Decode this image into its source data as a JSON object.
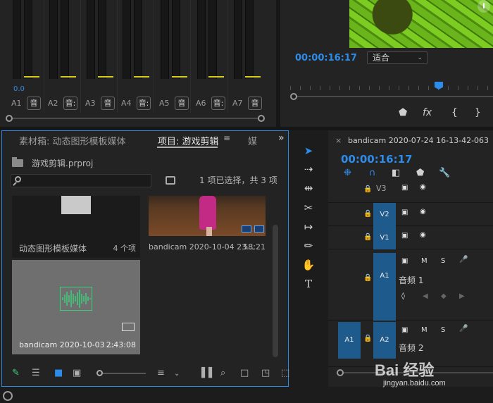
{
  "mixer": {
    "db_readout": "0.0",
    "channels": [
      {
        "label": "A1",
        "button": "音"
      },
      {
        "label": "A2",
        "button": "音:"
      },
      {
        "label": "A3",
        "button": "音"
      },
      {
        "label": "A4",
        "button": "音:"
      },
      {
        "label": "A5",
        "button": "音"
      },
      {
        "label": "A6",
        "button": "音:"
      },
      {
        "label": "A7",
        "button": "音"
      }
    ]
  },
  "monitor": {
    "info_icon": "i",
    "timecode": "00:00:16:17",
    "fit": "适合",
    "controls": [
      "⬟",
      "fx",
      "{",
      "}"
    ]
  },
  "project": {
    "tabs": [
      "素材箱: 动态图形模板媒体",
      "项目: 游戏剪辑",
      "媒"
    ],
    "menu_icon": "≡",
    "more_icon": "»",
    "file_name": "游戏剪辑.prproj",
    "selection_status": "1 项已选择，共 3 项",
    "items": [
      {
        "name": "动态图形模板媒体",
        "meta": "4 个项"
      },
      {
        "name": "bandicam 2020-10-04 23...",
        "meta": "58;21"
      },
      {
        "name": "bandicam 2020-10-03 ...",
        "meta": "2:43:08"
      }
    ]
  },
  "timeline": {
    "close": "×",
    "title": "bandicam 2020-07-24 16-13-42-063",
    "menu_icon": "≡",
    "timecode": "00:00:16:17",
    "tracks": [
      {
        "id": "V3",
        "name": ""
      },
      {
        "id": "V2",
        "name": ""
      },
      {
        "id": "V1",
        "name": ""
      },
      {
        "id": "A1",
        "name": "音频 1",
        "source": ""
      },
      {
        "id": "A2",
        "name": "音频 2",
        "source": "A1"
      }
    ],
    "track_buttons": {
      "mute": "M",
      "solo": "S"
    }
  },
  "watermark": {
    "main": "Bai 经验",
    "sub": "jingyan.baidu.com"
  },
  "colors": {
    "accent": "#2d8ceb",
    "meter": "#d8cc1a",
    "track_target": "#1f5a8c",
    "waveform": "#3ad17a"
  }
}
